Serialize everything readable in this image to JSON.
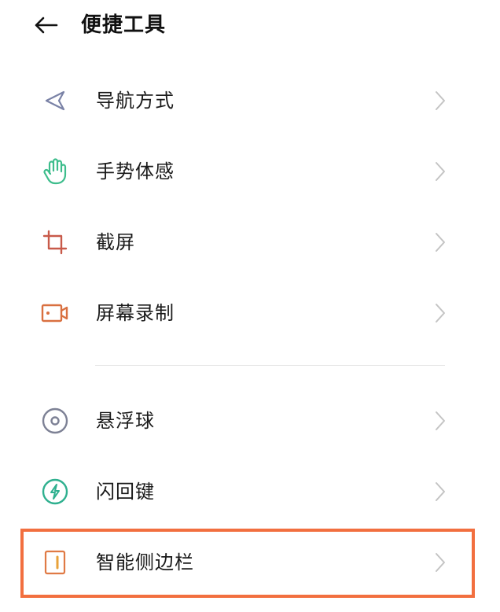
{
  "header": {
    "back_icon": "arrow-left-icon",
    "title": "便捷工具"
  },
  "group1": {
    "items": [
      {
        "label": "导航方式",
        "icon": "navigation-arrow-icon",
        "icon_color": "#7a82a6"
      },
      {
        "label": "手势体感",
        "icon": "hand-gesture-icon",
        "icon_color": "#3dbd8c"
      },
      {
        "label": "截屏",
        "icon": "crop-icon",
        "icon_color": "#c85a4a"
      },
      {
        "label": "屏幕录制",
        "icon": "video-camera-icon",
        "icon_color": "#d97040"
      }
    ]
  },
  "group2": {
    "items": [
      {
        "label": "悬浮球",
        "icon": "floating-ball-icon",
        "icon_color": "#7d8195"
      },
      {
        "label": "闪回键",
        "icon": "flash-bolt-icon",
        "icon_color": "#2fb08f"
      },
      {
        "label": "智能侧边栏",
        "icon": "sidebar-icon",
        "icon_color": "#e07a45"
      }
    ]
  },
  "chevron_icon": "chevron-right-icon",
  "colors": {
    "highlight": "#f26f3f",
    "chevron": "#c4c4c4",
    "divider": "#e6e6e6"
  }
}
